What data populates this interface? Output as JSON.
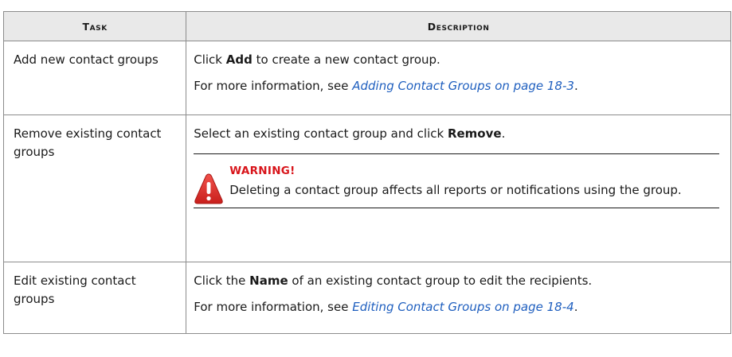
{
  "table": {
    "headers": {
      "task": "Task",
      "description": "Description"
    },
    "rows": [
      {
        "task": "Add new contact groups",
        "desc_line1": {
          "pre": "Click ",
          "bold": "Add",
          "post": " to create a new contact group."
        },
        "desc_line2": {
          "pre": "For more information, see ",
          "link": "Adding Contact Groups on page 18-3",
          "post": "."
        }
      },
      {
        "task": "Remove existing contact groups",
        "desc_line1": {
          "pre": "Select an existing contact group and click ",
          "bold": "Remove",
          "post": "."
        },
        "warning": {
          "title": "WARNING!",
          "text": "Deleting a contact group affects all reports or notifications using the group.",
          "icon": "warning-icon",
          "title_color": "#d8151b",
          "icon_color": "#e0322f"
        }
      },
      {
        "task": "Edit existing contact groups",
        "desc_line1": {
          "pre": "Click the ",
          "bold": "Name",
          "post": " of an existing contact group to edit the recipients."
        },
        "desc_line2": {
          "pre": "For more information, see ",
          "link": "Editing Contact Groups on page 18-4",
          "post": "."
        }
      }
    ]
  },
  "colors": {
    "header_bg": "#e9e9e9",
    "border": "#8c8c8c",
    "link": "#1f5fbf"
  }
}
